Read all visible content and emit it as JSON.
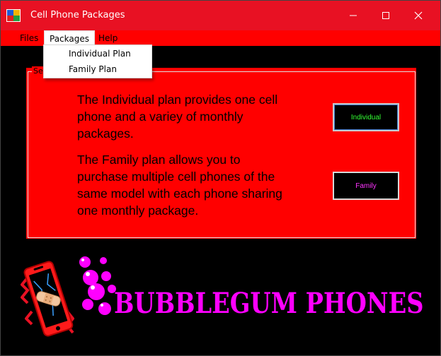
{
  "window": {
    "title": "Cell Phone Packages",
    "controls": {
      "minimize": "minimize-icon",
      "maximize": "maximize-icon",
      "close": "close-icon"
    }
  },
  "menu": {
    "items": [
      {
        "label": "Files"
      },
      {
        "label": "Packages"
      },
      {
        "label": "Help"
      }
    ],
    "active": "Packages"
  },
  "dropdown": {
    "items": [
      {
        "label": "Individual Plan"
      },
      {
        "label": "Family Plan"
      }
    ]
  },
  "group": {
    "legend": "Se",
    "individual_description": "The Individual plan provides one cell phone and a variey of monthly packages.",
    "family_description": "The Family plan allows you to purchase multiple cell phones of the same model with each phone sharing one monthly package."
  },
  "buttons": {
    "individual": "Individual",
    "family": "Family"
  },
  "logo": {
    "text": "BUBBLEGUM PHONES"
  },
  "colors": {
    "titlebar": "#e81123",
    "panel": "#ff0000",
    "background": "#000000",
    "individual_text": "#33ff33",
    "family_text": "#ff33ff",
    "logo": "#ff00ff"
  }
}
